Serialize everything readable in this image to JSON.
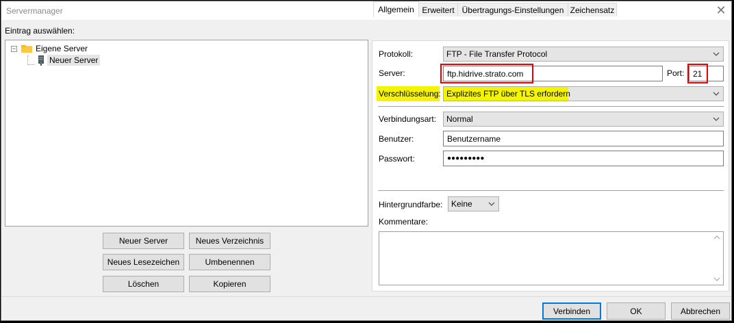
{
  "window": {
    "title": "Servermanager"
  },
  "left": {
    "select_label": "Eintrag auswählen:",
    "tree": {
      "root_label": "Eigene Server",
      "child_label": "Neuer Server"
    },
    "buttons": {
      "new_server": "Neuer Server",
      "new_folder": "Neues Verzeichnis",
      "new_bookmark": "Neues Lesezeichen",
      "rename": "Umbenennen",
      "delete": "Löschen",
      "copy": "Kopieren"
    }
  },
  "tabs": [
    "Allgemein",
    "Erweitert",
    "Übertragungs-Einstellungen",
    "Zeichensatz"
  ],
  "form": {
    "protocol_label": "Protokoll:",
    "protocol_value": "FTP - File Transfer Protocol",
    "server_label": "Server:",
    "server_value": "ftp.hidrive.strato.com",
    "port_label": "Port:",
    "port_value": "21",
    "encryption_label": "Verschlüsselung:",
    "encryption_value": "Explizites FTP über TLS erfordern",
    "conn_type_label": "Verbindungsart:",
    "conn_type_value": "Normal",
    "user_label": "Benutzer:",
    "user_value": "Benutzername",
    "password_label": "Passwort:",
    "password_value": "●●●●●●●●●",
    "bg_color_label": "Hintergrundfarbe:",
    "bg_color_value": "Keine",
    "comments_label": "Kommentare:"
  },
  "footer": {
    "connect": "Verbinden",
    "ok": "OK",
    "cancel": "Abbrechen"
  },
  "colors": {
    "highlight": "#f4f400",
    "annotation_red": "#e00000",
    "default_button_border": "#0078d7"
  }
}
